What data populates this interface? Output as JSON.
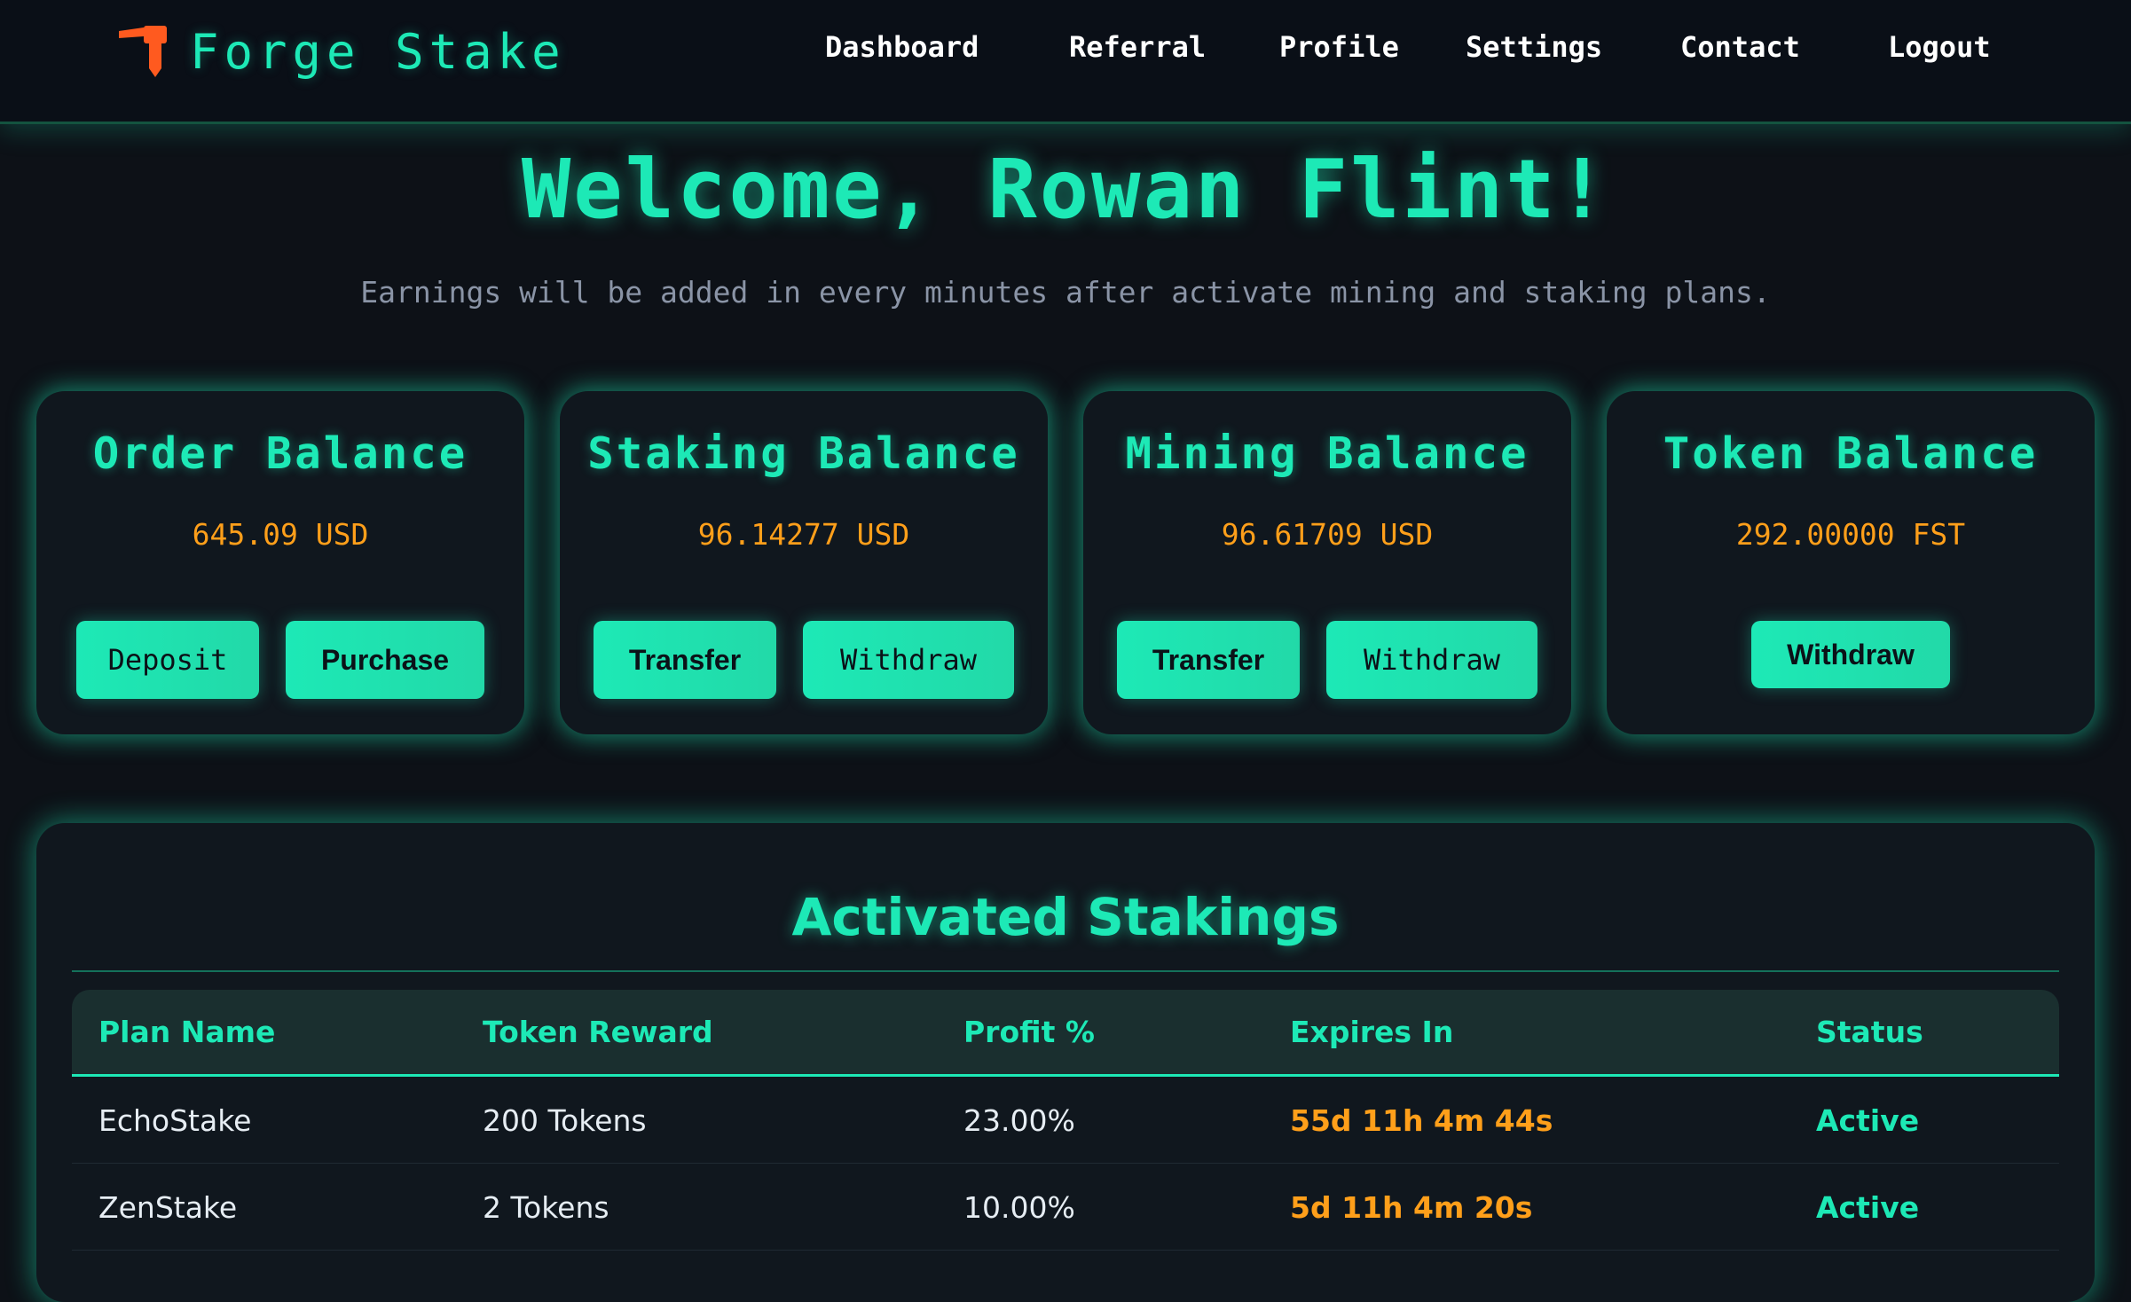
{
  "app": {
    "brand": "Forge Stake"
  },
  "nav": {
    "items": [
      "Dashboard",
      "Referral",
      "Profile",
      "Settings",
      "Contact",
      "Logout"
    ]
  },
  "hero": {
    "welcome": "Welcome, Rowan Flint!",
    "subtitle": "Earnings will be added in every minutes after activate mining and staking plans."
  },
  "cards": [
    {
      "title": "Order Balance",
      "amount": "645.09 USD",
      "buttons": [
        "Deposit",
        "Purchase"
      ]
    },
    {
      "title": "Staking Balance",
      "amount": "96.14277 USD",
      "buttons": [
        "Transfer",
        "Withdraw"
      ]
    },
    {
      "title": "Mining Balance",
      "amount": "96.61709 USD",
      "buttons": [
        "Transfer",
        "Withdraw"
      ]
    },
    {
      "title": "Token Balance",
      "amount": "292.00000 FST",
      "buttons": [
        "Withdraw"
      ]
    }
  ],
  "stakings": {
    "title": "Activated Stakings",
    "columns": [
      "Plan Name",
      "Token Reward",
      "Profit %",
      "Expires In",
      "Status"
    ],
    "rows": [
      {
        "plan": "EchoStake",
        "reward": "200 Tokens",
        "profit": "23.00%",
        "expires": "55d 11h 4m 44s",
        "status": "Active"
      },
      {
        "plan": "ZenStake",
        "reward": "2 Tokens",
        "profit": "10.00%",
        "expires": "5d 11h 4m 20s",
        "status": "Active"
      }
    ]
  },
  "colors": {
    "accent": "#1de9b6",
    "amount": "#ff9f1a",
    "background": "#0d1117",
    "card": "#10171e",
    "logo": "#ff5a1f"
  }
}
